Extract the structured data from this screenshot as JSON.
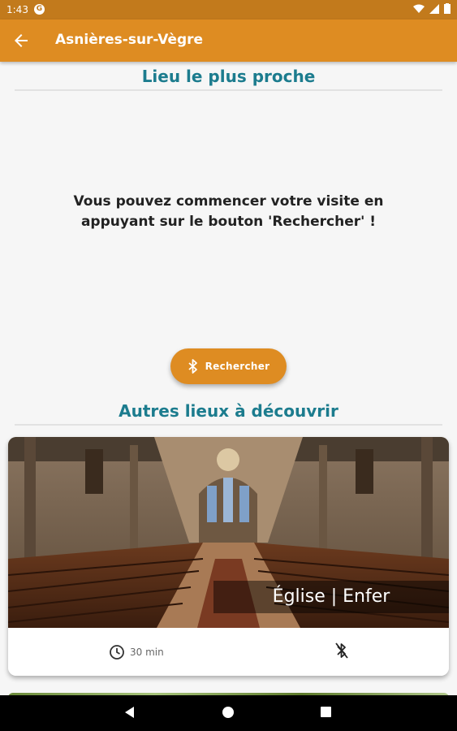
{
  "status_bar": {
    "time": "1:43",
    "g_icon_letter": "G"
  },
  "app_bar": {
    "title": "Asnières-sur-Vègre"
  },
  "nearest": {
    "title": "Lieu le plus proche",
    "message": "Vous pouvez commencer votre visite en appuyant sur le bouton 'Rechercher' !",
    "button_label": "Rechercher"
  },
  "others": {
    "title": "Autres lieux à découvrir",
    "places": [
      {
        "name": "Église | Enfer",
        "duration": "30 min",
        "icon": "bluetooth-disabled-icon"
      }
    ]
  },
  "colors": {
    "primary": "#de8c22",
    "status_bar": "#c27a1c",
    "title_teal": "#1c7c8e"
  }
}
